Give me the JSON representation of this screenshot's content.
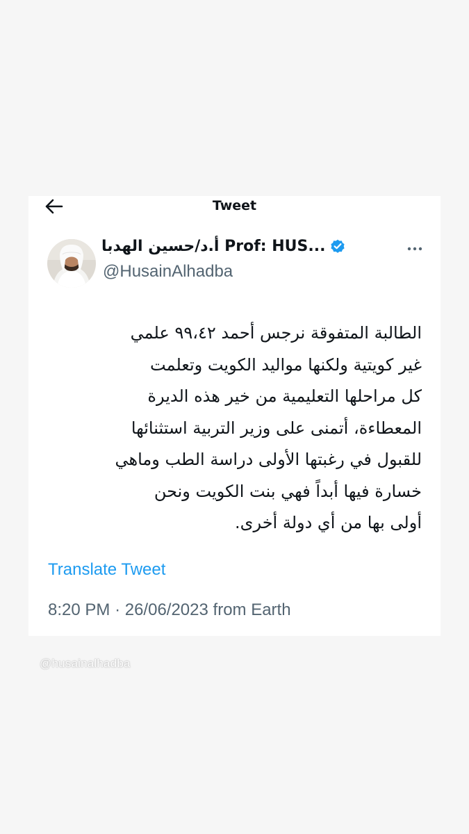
{
  "header": {
    "title": "Tweet"
  },
  "author": {
    "display_name": "أ.د/حسين الهدبا Prof: HUS...",
    "handle": "@HusainAlhadba",
    "verified": true
  },
  "tweet": {
    "lines": [
      "الطالبة المتفوقة نرجس أحمد ٩٩،٤٢ علمي",
      "غير كويتية ولكنها مواليد الكويت وتعلمت",
      "كل مراحلها التعليمية من خير هذه الديرة",
      "المعطاءة، أتمنى على وزير التربية استثنائها",
      "للقبول في رغبتها الأولى دراسة الطب وماهي",
      "خسارة فيها أبداً فهي بنت الكويت ونحن",
      "أولى بها من أي دولة أخرى."
    ],
    "translate_label": "Translate Tweet",
    "time": "8:20 PM",
    "separator": "·",
    "date": "26/06/2023",
    "source": "from Earth"
  },
  "watermark": "@husainalhadba",
  "colors": {
    "link": "#1d9bf0",
    "verified": "#1d9bf0",
    "secondary_text": "#536471",
    "primary_text": "#0f1419",
    "background": "#f6f6f6",
    "card": "#ffffff"
  },
  "icons": {
    "back": "arrow-left-icon",
    "more": "more-horizontal-icon",
    "verified": "verified-badge-icon"
  }
}
